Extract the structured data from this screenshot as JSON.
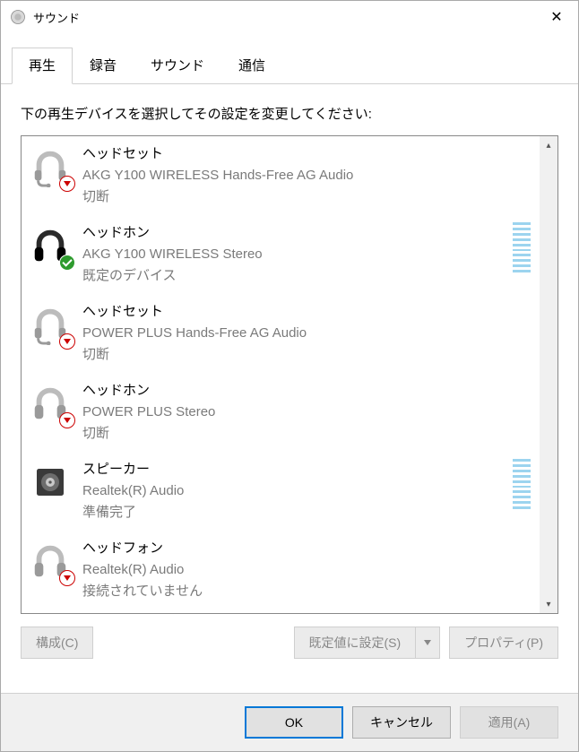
{
  "window": {
    "title": "サウンド"
  },
  "tabs": [
    {
      "label": "再生",
      "active": true
    },
    {
      "label": "録音",
      "active": false
    },
    {
      "label": "サウンド",
      "active": false
    },
    {
      "label": "通信",
      "active": false
    }
  ],
  "instruction": "下の再生デバイスを選択してその設定を変更してください:",
  "devices": [
    {
      "type": "ヘッドセット",
      "name": "AKG Y100 WIRELESS Hands-Free AG Audio",
      "status": "切断",
      "icon": "headset",
      "badge": "down",
      "meter": false
    },
    {
      "type": "ヘッドホン",
      "name": "AKG Y100 WIRELESS Stereo",
      "status": "既定のデバイス",
      "icon": "headphones-dark",
      "badge": "check",
      "meter": true
    },
    {
      "type": "ヘッドセット",
      "name": "POWER PLUS Hands-Free AG Audio",
      "status": "切断",
      "icon": "headset",
      "badge": "down",
      "meter": false
    },
    {
      "type": "ヘッドホン",
      "name": "POWER PLUS Stereo",
      "status": "切断",
      "icon": "headphones",
      "badge": "down",
      "meter": false
    },
    {
      "type": "スピーカー",
      "name": "Realtek(R) Audio",
      "status": "準備完了",
      "icon": "speaker",
      "badge": null,
      "meter": true
    },
    {
      "type": "ヘッドフォン",
      "name": "Realtek(R) Audio",
      "status": "接続されていません",
      "icon": "headphones",
      "badge": "down",
      "meter": false
    }
  ],
  "panel_buttons": {
    "configure": "構成(C)",
    "set_default": "既定値に設定(S)",
    "properties": "プロパティ(P)"
  },
  "footer_buttons": {
    "ok": "OK",
    "cancel": "キャンセル",
    "apply": "適用(A)"
  }
}
